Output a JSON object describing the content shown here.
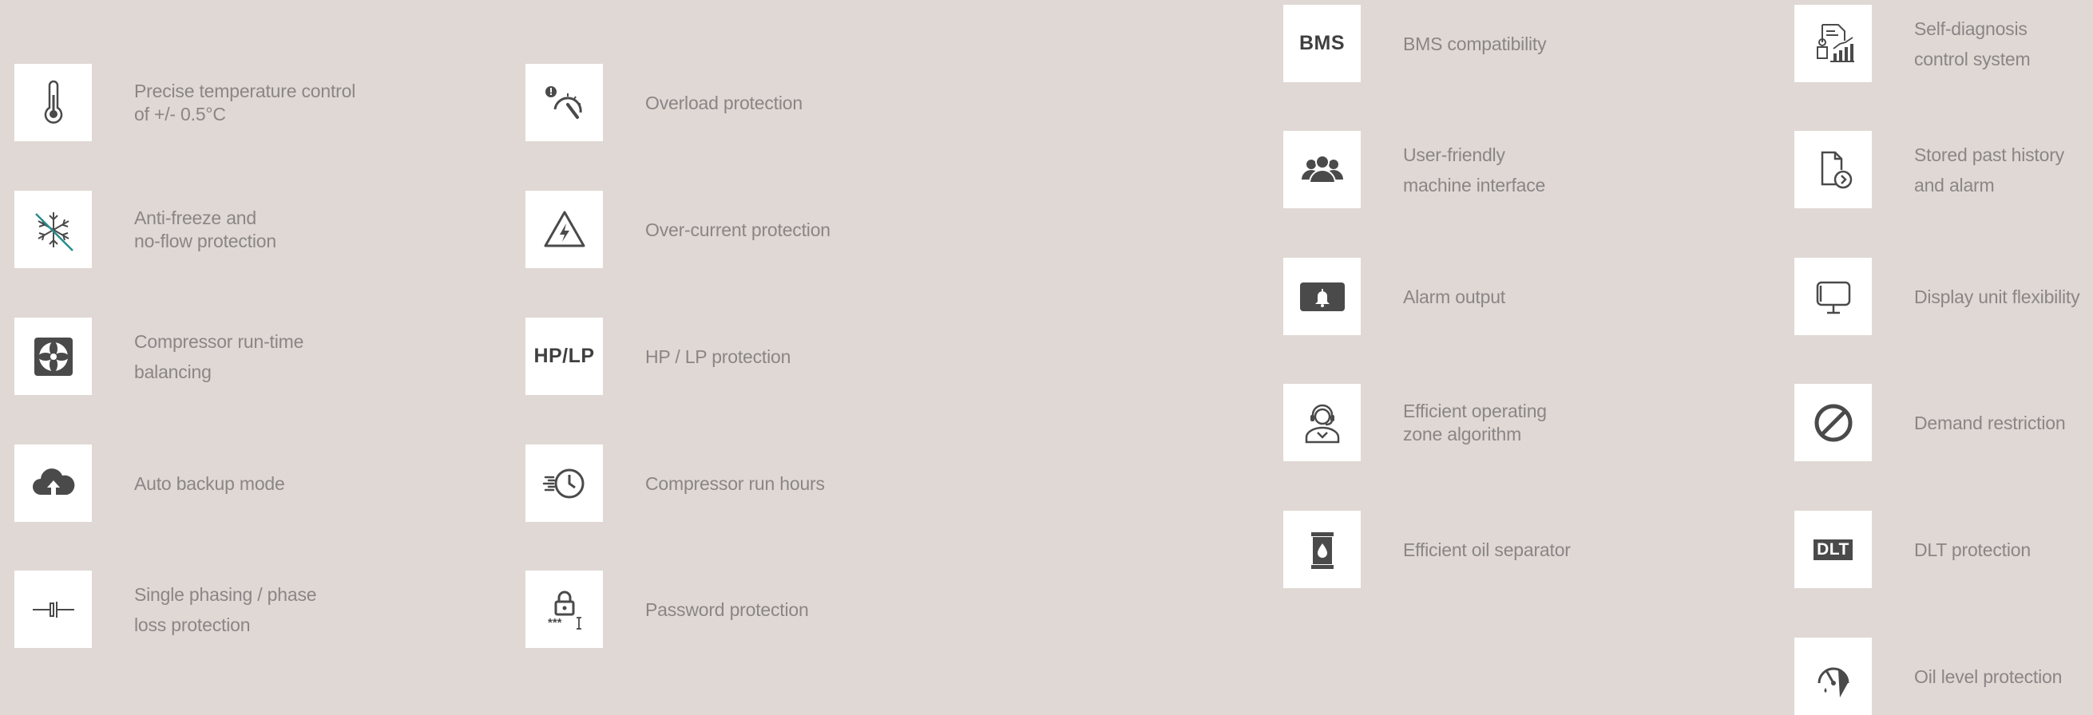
{
  "colors": {
    "background": "#e0d8d4",
    "tile": "#ffffff",
    "icon": "#4a4a4a",
    "text": "#8a8686"
  },
  "features": [
    {
      "icon": "thermometer-icon",
      "label": "Precise temperature control\nof +/- 0.5°C"
    },
    {
      "icon": "snowflake-crossed-icon",
      "label": "Anti-freeze and\nno-flow protection"
    },
    {
      "icon": "fan-icon",
      "label": "Compressor run-time\nbalancing"
    },
    {
      "icon": "cloud-upload-icon",
      "label": "Auto backup mode"
    },
    {
      "icon": "capacitor-icon",
      "label": "Single phasing / phase\nloss protection"
    },
    {
      "icon": "gauge-warning-icon",
      "label": "Overload protection"
    },
    {
      "icon": "high-voltage-warning-icon",
      "label": "Over-current protection"
    },
    {
      "icon": "hp-lp-icon",
      "icon_text": "HP/LP",
      "label": "HP / LP protection"
    },
    {
      "icon": "clock-speed-icon",
      "label": "Compressor run hours"
    },
    {
      "icon": "lock-password-icon",
      "label": "Password protection"
    },
    {
      "icon": "bms-icon",
      "icon_text": "BMS",
      "label": "BMS compatibility"
    },
    {
      "icon": "users-icon",
      "label": "User-friendly\nmachine interface"
    },
    {
      "icon": "alarm-bell-icon",
      "label": "Alarm output"
    },
    {
      "icon": "operator-headset-icon",
      "label": "Efficient operating\nzone algorithm"
    },
    {
      "icon": "oil-barrel-icon",
      "label": "Efficient oil separator"
    },
    {
      "icon": "report-chart-icon",
      "label": "Self-diagnosis\ncontrol system"
    },
    {
      "icon": "file-history-icon",
      "label": "Stored past history\nand alarm"
    },
    {
      "icon": "monitor-icon",
      "label": "Display unit flexibility"
    },
    {
      "icon": "prohibited-icon",
      "label": "Demand restriction"
    },
    {
      "icon": "dlt-icon",
      "icon_text": "DLT",
      "label": "DLT protection"
    },
    {
      "icon": "oil-level-gauge-icon",
      "label": "Oil level protection"
    }
  ]
}
